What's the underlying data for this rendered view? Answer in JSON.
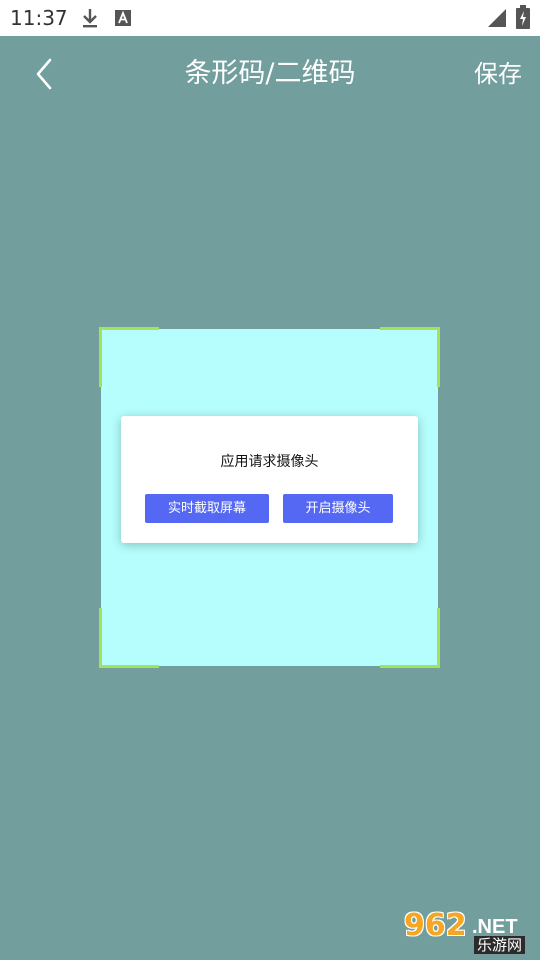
{
  "status_bar": {
    "time": "11:37",
    "icons": [
      "download-icon",
      "a-badge-icon",
      "signal-icon",
      "battery-icon"
    ]
  },
  "app_bar": {
    "back_icon": "chevron-left-icon",
    "title": "条形码/二维码",
    "save_label": "保存"
  },
  "scanner": {
    "frame_color": "#b5fefd",
    "corner_color": "#a3e35a"
  },
  "dialog": {
    "message": "应用请求摄像头",
    "buttons": [
      {
        "label": "实时截取屏幕"
      },
      {
        "label": "开启摄像头"
      }
    ],
    "button_color": "#5468f4"
  },
  "watermark": {
    "number": "962",
    "suffix": ".NET",
    "chinese": "乐游网"
  },
  "colors": {
    "background": "#729e9e",
    "accent": "#5468f4"
  }
}
